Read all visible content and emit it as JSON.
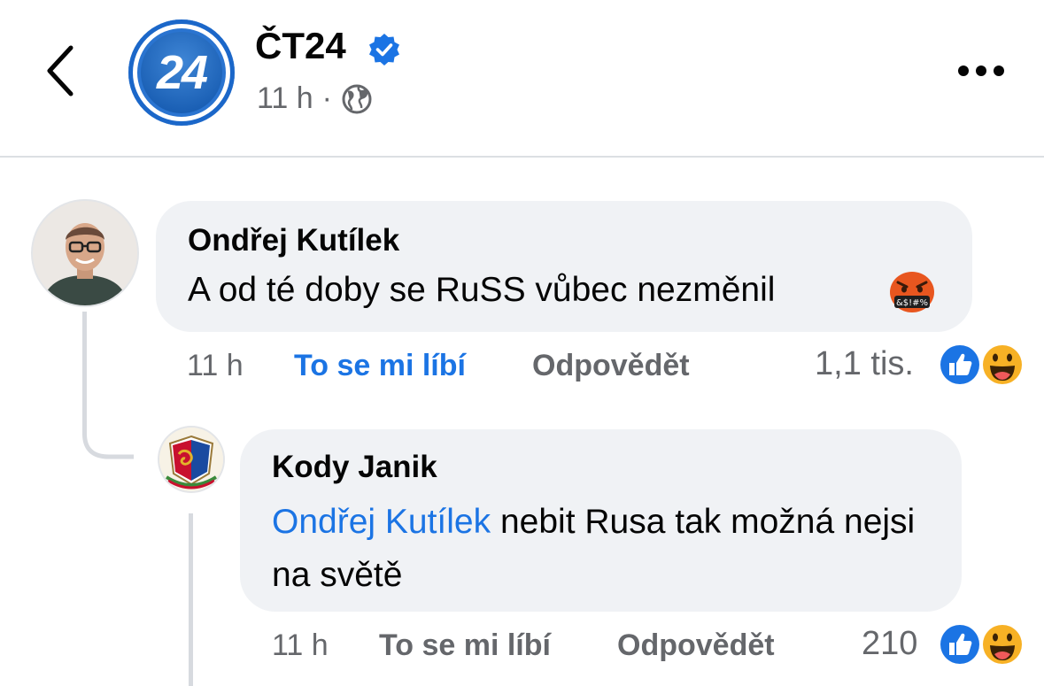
{
  "header": {
    "avatar_text": "24",
    "page_name": "ČT24",
    "time": "11 h",
    "separator": "·"
  },
  "comments": [
    {
      "author": "Ondřej Kutílek",
      "text": "A od té doby se RuSS vůbec nezměnil",
      "emoji": "rage-face",
      "time": "11 h",
      "like_label": "To se mi líbí",
      "reply_label": "Odpovědět",
      "reaction_count": "1,1 tis."
    },
    {
      "author": "Kody Janik",
      "mention": "Ondřej Kutílek",
      "text": " nebit Rusa tak možná nejsi na světě",
      "time": "11 h",
      "like_label": "To se mi líbí",
      "reply_label": "Odpovědět",
      "reaction_count": "210"
    }
  ],
  "colors": {
    "accent": "#1b74e4",
    "bubble": "#f0f2f5",
    "secondary_text": "#65676b"
  }
}
